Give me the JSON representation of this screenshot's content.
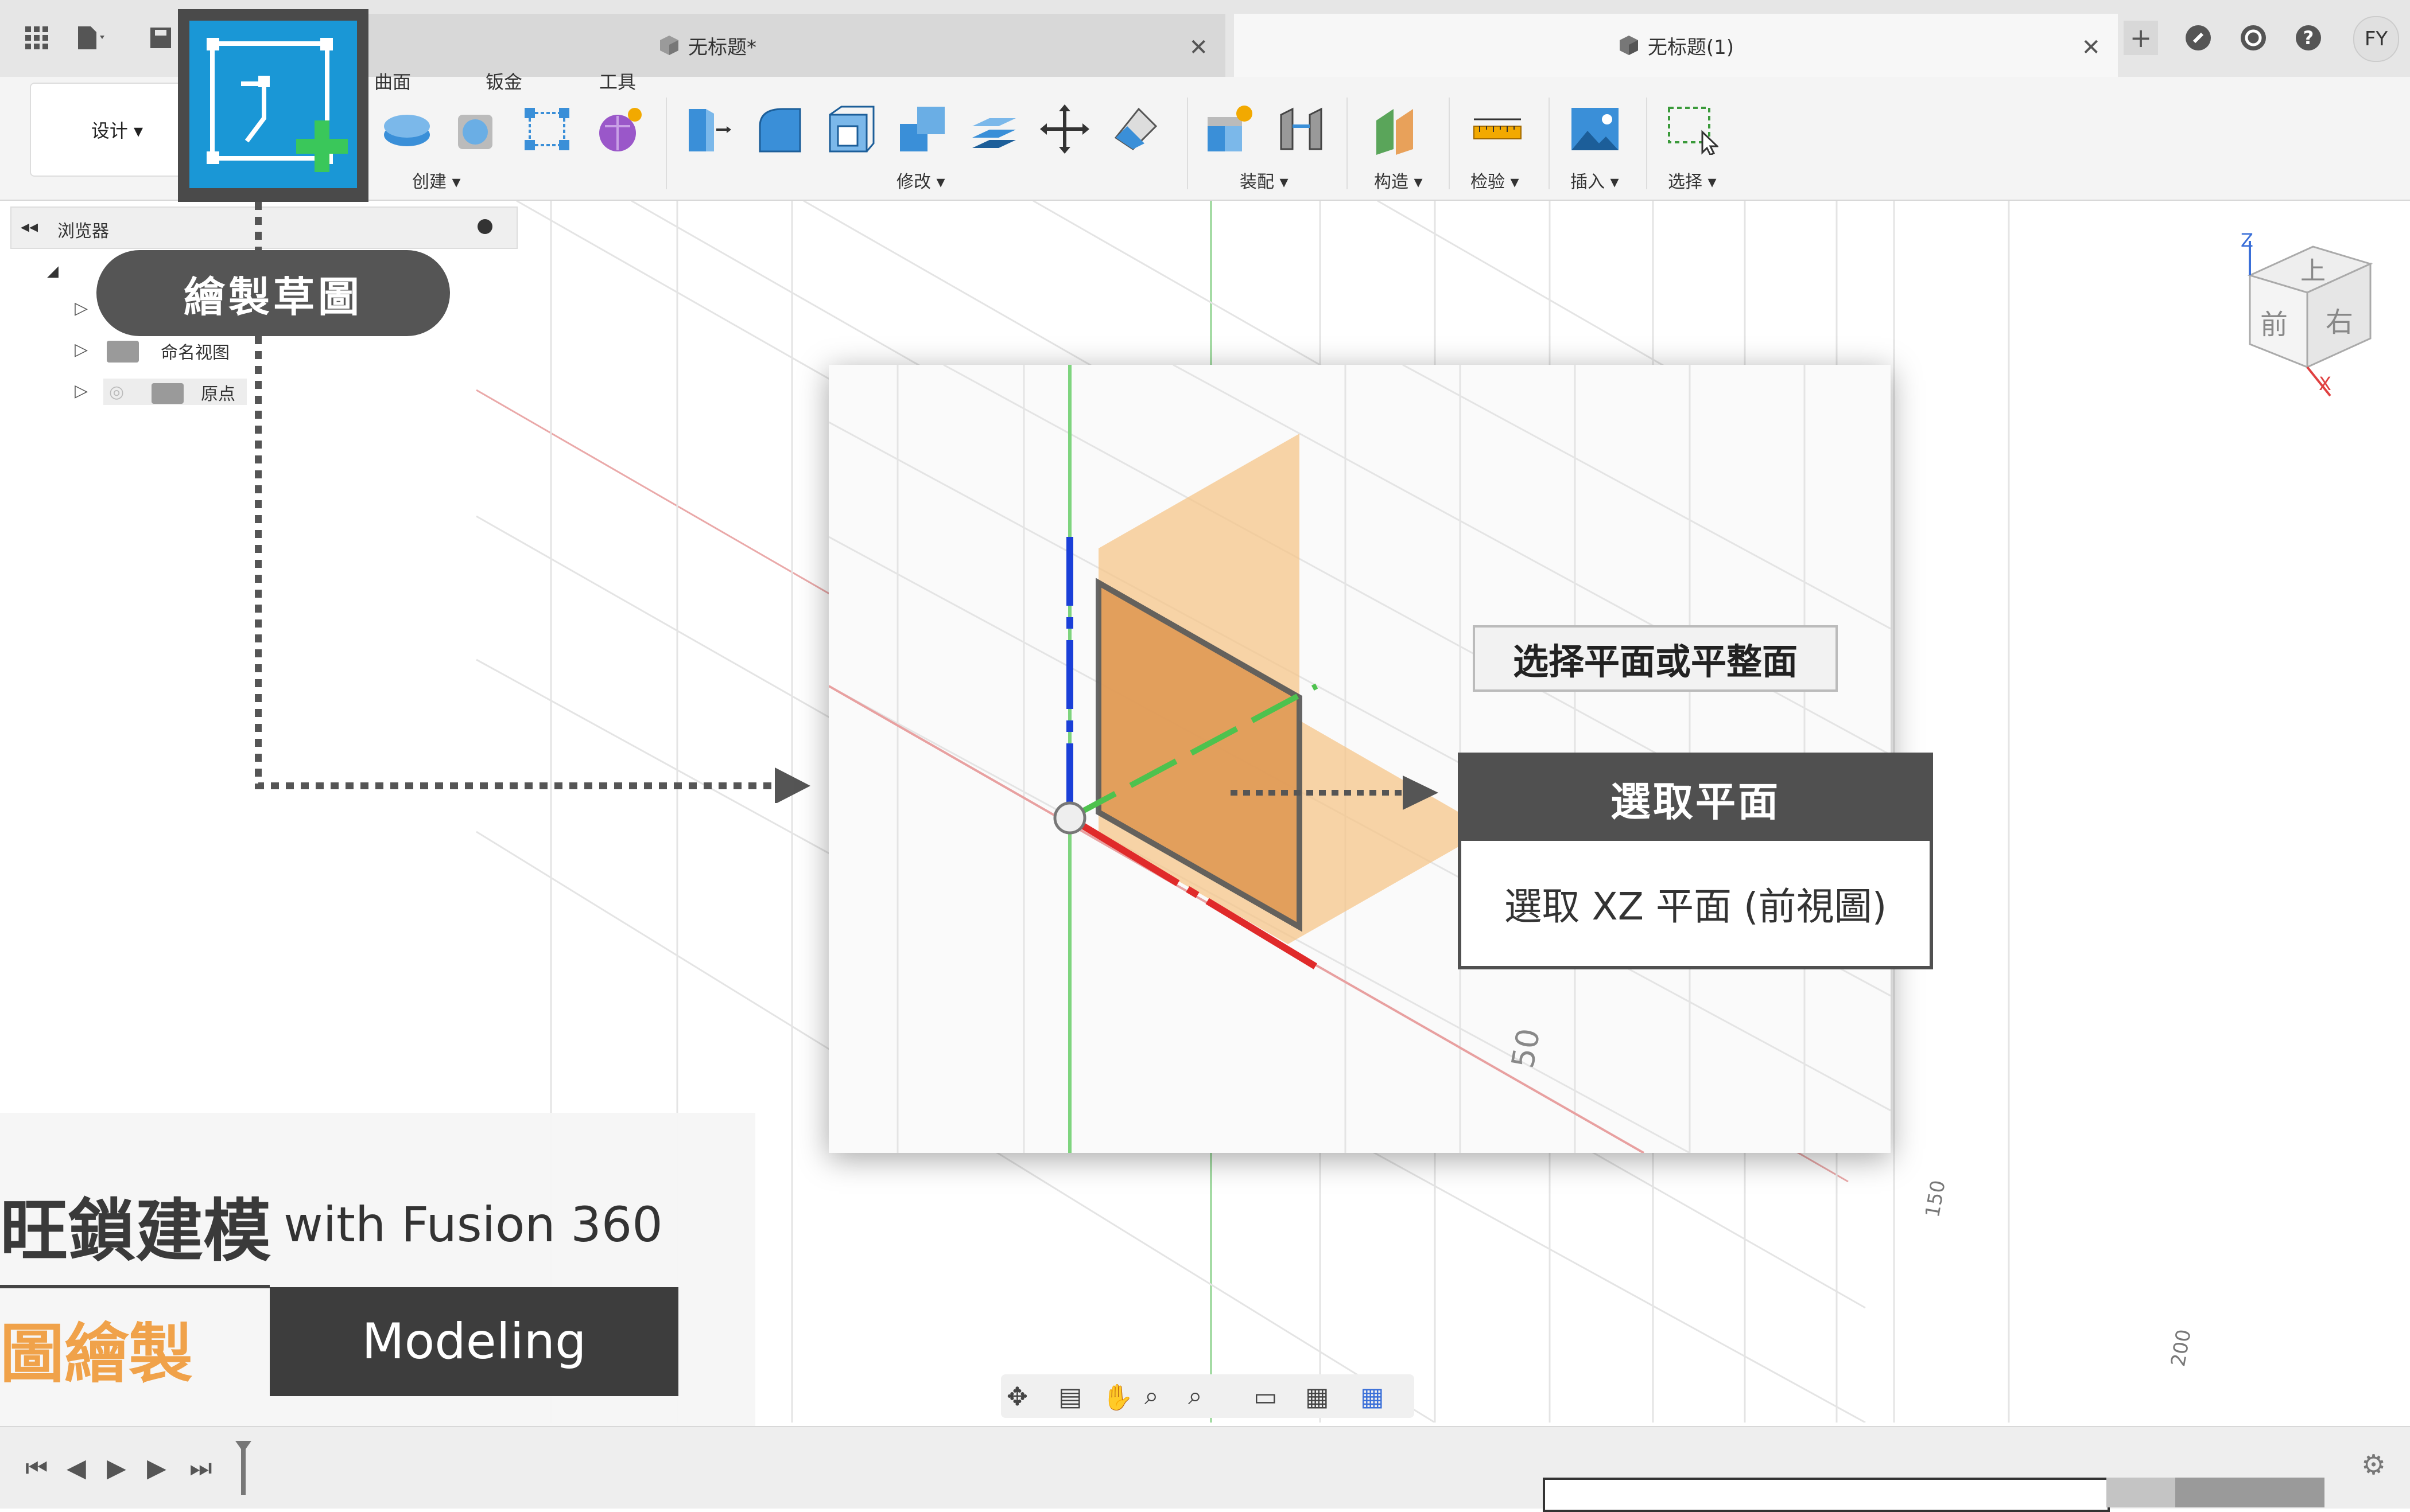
{
  "tabs": [
    {
      "label": "无标题*",
      "active": false
    },
    {
      "label": "无标题(1)",
      "active": true
    }
  ],
  "user_initials": "FY",
  "ribbon": {
    "design_label": "设计 ▾",
    "tab_labels": [
      "曲面",
      "钣金",
      "工具"
    ],
    "groups": [
      {
        "label": "创建 ▾"
      },
      {
        "label": "修改 ▾"
      },
      {
        "label": "装配 ▾"
      },
      {
        "label": "构造 ▾"
      },
      {
        "label": "检验 ▾"
      },
      {
        "label": "插入 ▾"
      },
      {
        "label": "选择 ▾"
      }
    ]
  },
  "browser": {
    "title": "浏览器",
    "items": [
      {
        "label": "命名视图"
      },
      {
        "label": "原点"
      }
    ]
  },
  "viewcube": {
    "faces": [
      "上",
      "前",
      "右"
    ],
    "axis_z": "Z",
    "axis_x": "X"
  },
  "callout_sketch": "繪製草圖",
  "tooltip": "选择平面或平整面",
  "step": {
    "title": "選取平面",
    "description": "選取 XZ 平面 (前視圖)"
  },
  "grid_labels": [
    "50",
    "150",
    "200"
  ],
  "banner": {
    "title": "旺鎖建模",
    "subtitle": "with Fusion 360",
    "chapter": "圖繪製",
    "section": "Modeling"
  },
  "colors": {
    "accent_blue": "#1a97d6",
    "callout_dark": "#555555",
    "plane_orange": "#e8a15a",
    "chapter_orange": "#f0a24a"
  }
}
